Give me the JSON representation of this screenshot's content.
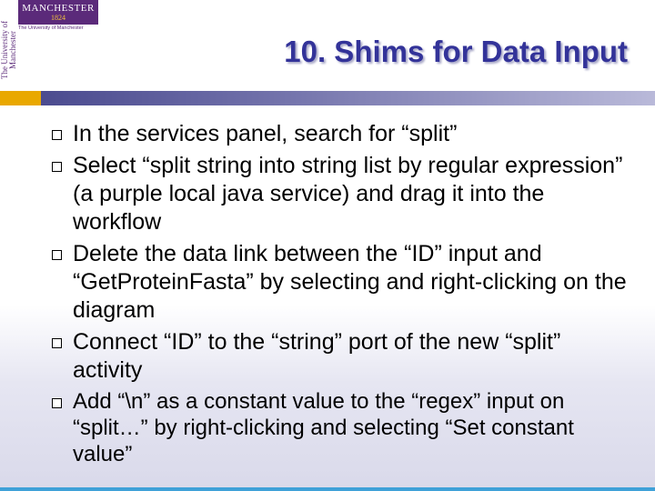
{
  "logo": {
    "name": "MANCHESTER",
    "year": "1824",
    "subtitle": "The University of Manchester",
    "side_text": "The University of Manchester"
  },
  "slide": {
    "title": "10. Shims for Data Input",
    "bullets": [
      "In the services panel, search for “split”",
      "Select “split string into string list by regular expression” (a purple local java service) and drag it into the workflow",
      "Delete the data link between the “ID” input and “GetProteinFasta” by selecting and right-clicking on the diagram",
      "Connect “ID” to the “string” port of the new “split” activity",
      "Add “\\n” as a constant value to the “regex” input on “split…” by right-clicking and selecting “Set constant value”"
    ]
  },
  "colors": {
    "title": "#333399",
    "accent_gold": "#e9a800",
    "accent_purple": "#4b4b8f",
    "logo_purple": "#5b2a7a"
  }
}
